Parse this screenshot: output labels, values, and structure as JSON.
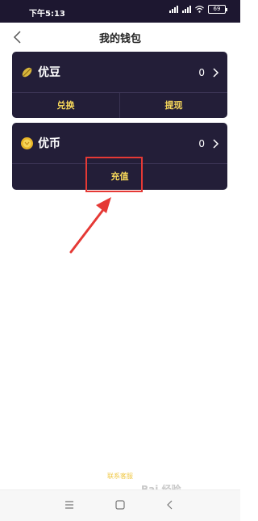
{
  "status_bar": {
    "time": "下午5:13",
    "battery": "69"
  },
  "header": {
    "title": "我的钱包"
  },
  "youdou": {
    "name": "优豆",
    "amount": "0",
    "action_left": "兑换",
    "action_right": "提现"
  },
  "youbi": {
    "name": "优币",
    "amount": "0",
    "action": "充值"
  },
  "footer": {
    "contact": "联系客服"
  },
  "watermark": {
    "text": "Bai 经验"
  },
  "colors": {
    "card_bg": "#231e38",
    "accent": "#f5d65a",
    "highlight": "#e53935"
  }
}
